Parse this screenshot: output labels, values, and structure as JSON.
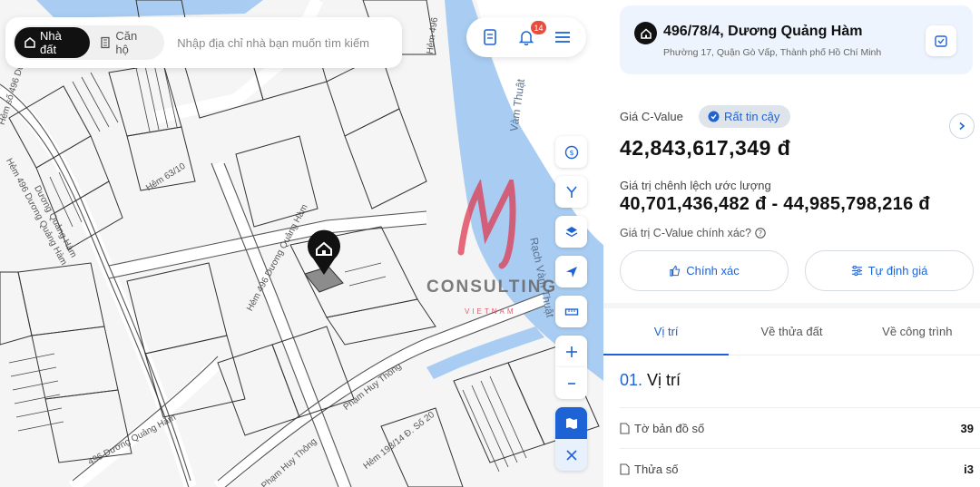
{
  "search": {
    "segments": [
      "Nhà đất",
      "Căn hộ"
    ],
    "active_segment": 0,
    "placeholder": "Nhập địa chỉ nhà bạn muốn tìm kiếm"
  },
  "topbar": {
    "notification_count": "14",
    "icons": [
      "document-icon",
      "bell-icon",
      "menu-icon"
    ]
  },
  "map": {
    "road_labels": [
      "Hẻm 496",
      "Hẻm 63/10",
      "Dương Quảng Hàm",
      "Hẻm 496 Dương Quảng Hàm",
      "Hẻm 193/14 Đ. Số 20",
      "Phạm Huy Thông",
      "Phạm Huy Thông",
      "496 Dương Quảng Hàm",
      "Hẻm số 496 Dương",
      "Hẻm 496 Dương Quảng Hàm"
    ],
    "river_labels": [
      "Vàm Thuật",
      "Rạch Vàm Thuật"
    ],
    "watermark": {
      "text": "CONSULTING",
      "sub": "VIETNAM"
    },
    "tools": [
      "currency-icon",
      "route-icon",
      "layers-icon",
      "locate-icon",
      "ruler-icon",
      "zoom-in-icon",
      "zoom-out-icon",
      "map-view-icon",
      "satellite-icon"
    ]
  },
  "panel": {
    "address_title": "496/78/4, Dương Quảng Hàm",
    "address_sub": "Phường 17, Quận Gò Vấp, Thành phố Hồ Chí Minh",
    "cvalue_label": "Giá C-Value",
    "trust_label": "Rất tin cậy",
    "price": "42,843,617,349 đ",
    "range_label": "Giá trị chênh lệch ước lượng",
    "range_value": "40,701,436,482 đ - 44,985,798,216 đ",
    "accuracy_question": "Giá trị C-Value chính xác?",
    "btn_correct": "Chính xác",
    "btn_self_price": "Tự định giá",
    "tabs": [
      "Vị trí",
      "Về thửa đất",
      "Về công trình"
    ],
    "active_tab": 0,
    "section_num": "01.",
    "section_title": "Vị trí",
    "rows": [
      {
        "label": "Tờ bản đồ số",
        "value": "39"
      },
      {
        "label": "Thửa số",
        "value": "i3"
      }
    ]
  },
  "colors": {
    "accent": "#1e63d6",
    "river": "#a9cdf2",
    "badge": "#e74c3c"
  }
}
